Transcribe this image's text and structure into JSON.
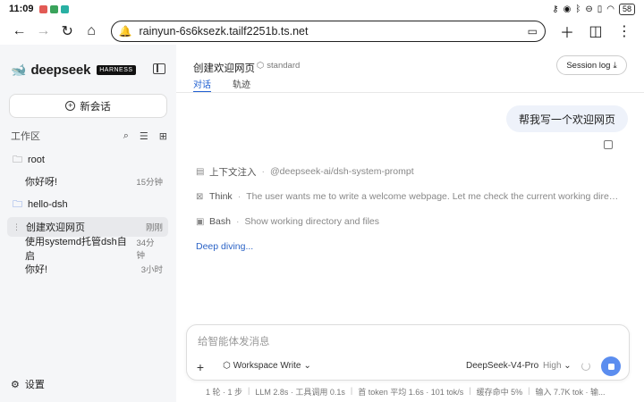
{
  "statusbar": {
    "time": "11:09",
    "battery": "58"
  },
  "browser": {
    "url": "rainyun-6s6ksezk.tailf2251b.ts.net"
  },
  "sidebar": {
    "brand": "deepseek",
    "brand_badge": "HARNESS",
    "new_chat": "新会话",
    "workspace_label": "工作区",
    "tree": [
      {
        "label": "root",
        "type": "folder"
      },
      {
        "label": "你好呀!",
        "meta": "15分钟",
        "type": "chat"
      },
      {
        "label": "hello-dsh",
        "type": "folder"
      },
      {
        "label": "创建欢迎网页",
        "meta": "刚刚",
        "type": "chat",
        "active": true
      },
      {
        "label": "使用systemd托管dsh自启",
        "meta": "34分钟",
        "type": "chat"
      },
      {
        "label": "你好!",
        "meta": "3小时",
        "type": "chat"
      }
    ],
    "settings": "设置"
  },
  "main": {
    "title": "创建欢迎网页",
    "mode": "standard",
    "session_log": "Session log",
    "tabs": [
      {
        "label": "对话",
        "active": true
      },
      {
        "label": "轨迹"
      }
    ],
    "user_message": "帮我写一个欢迎网页",
    "steps": [
      {
        "icon": "document-icon",
        "name": "上下文注入",
        "detail": "@deepseek-ai/dsh-system-prompt"
      },
      {
        "icon": "think-icon",
        "name": "Think",
        "detail": "The user wants me to write a welcome webpage. Let me check the current working directo..."
      },
      {
        "icon": "terminal-icon",
        "name": "Bash",
        "detail": "Show working directory and files"
      }
    ],
    "deep_diving": "Deep diving..."
  },
  "composer": {
    "placeholder": "给智能体发消息",
    "workspace_mode": "Workspace Write",
    "model": "DeepSeek-V4-Pro",
    "level": "High"
  },
  "stats": [
    "1 轮 · 1 步",
    "LLM 2.8s · 工具调用 0.1s",
    "首 token 平均 1.6s · 101 tok/s",
    "缓存命中 5%",
    "输入 7.7K tok · 输..."
  ],
  "colors": {
    "accent": "#1f5fd1",
    "stop_button": "#5b8def",
    "sidebar_bg": "#f5f6f8",
    "bubble_bg": "#eef2fa"
  }
}
